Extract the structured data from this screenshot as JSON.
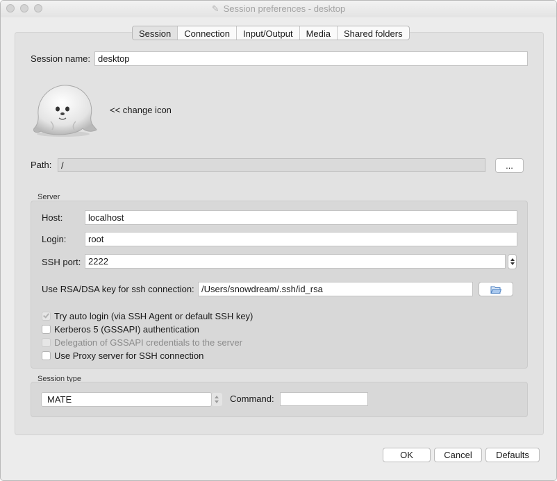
{
  "window": {
    "title": "Session preferences - desktop"
  },
  "tabs": [
    {
      "label": "Session",
      "active": true
    },
    {
      "label": "Connection"
    },
    {
      "label": "Input/Output"
    },
    {
      "label": "Media"
    },
    {
      "label": "Shared folders"
    }
  ],
  "session": {
    "name_label": "Session name:",
    "name_value": "desktop",
    "change_icon_label": "<< change icon",
    "icon": "seal-icon",
    "path_label": "Path:",
    "path_value": "/",
    "browse_label": "..."
  },
  "server": {
    "group_title": "Server",
    "host_label": "Host:",
    "host_value": "localhost",
    "login_label": "Login:",
    "login_value": "root",
    "ssh_port_label": "SSH port:",
    "ssh_port_value": "2222",
    "rsa_label": "Use RSA/DSA key for ssh connection:",
    "rsa_value": "/Users/snowdream/.ssh/id_rsa",
    "rsa_browse_icon": "folder-open-icon",
    "checks": [
      {
        "label": "Try auto login (via SSH Agent or default SSH key)",
        "checked": true,
        "disabled": true
      },
      {
        "label": "Kerberos 5 (GSSAPI) authentication",
        "checked": false,
        "disabled": false
      },
      {
        "label": "Delegation of GSSAPI credentials to the server",
        "checked": false,
        "disabled": true
      },
      {
        "label": "Use Proxy server for SSH connection",
        "checked": false,
        "disabled": false
      }
    ]
  },
  "session_type": {
    "group_title": "Session type",
    "selected": "MATE",
    "command_label": "Command:",
    "command_value": ""
  },
  "buttons": {
    "ok": "OK",
    "cancel": "Cancel",
    "defaults": "Defaults"
  }
}
